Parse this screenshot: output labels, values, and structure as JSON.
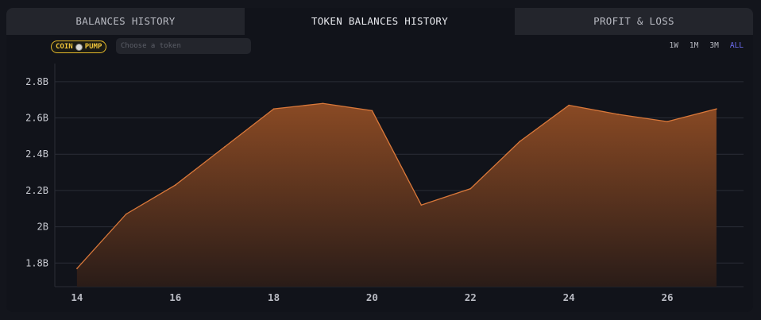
{
  "tabs": [
    {
      "label": "BALANCES HISTORY"
    },
    {
      "label": "TOKEN BALANCES HISTORY"
    },
    {
      "label": "PROFIT & LOSS"
    }
  ],
  "token_badge": {
    "left": "COIN",
    "right": "PUMP"
  },
  "token_search": {
    "placeholder": "Choose a token",
    "value": ""
  },
  "ranges": [
    "1W",
    "1M",
    "3M",
    "ALL"
  ],
  "active_range": "ALL",
  "colors": {
    "accent": "#6d6cf0",
    "line": "#d9783a",
    "badge": "#e3b82a"
  },
  "chart_data": {
    "type": "area",
    "x": [
      14,
      15,
      16,
      17,
      18,
      19,
      20,
      21,
      22,
      23,
      24,
      25,
      26,
      27
    ],
    "x_ticks": [
      "14",
      "16",
      "18",
      "20",
      "22",
      "24",
      "26"
    ],
    "y_ticks": [
      "1.8B",
      "2B",
      "2.2B",
      "2.4B",
      "2.6B",
      "2.8B"
    ],
    "y_tick_values": [
      1.8,
      2.0,
      2.2,
      2.4,
      2.6,
      2.8
    ],
    "series": [
      {
        "values": [
          1.77,
          2.07,
          2.23,
          2.44,
          2.65,
          2.68,
          2.64,
          2.12,
          2.21,
          2.47,
          2.67,
          2.62,
          2.58,
          2.65
        ]
      }
    ],
    "unit": "B",
    "ylim": [
      1.67,
      2.9
    ],
    "xlim": [
      13.55,
      27.55
    ],
    "grid": true,
    "legend": "none"
  }
}
